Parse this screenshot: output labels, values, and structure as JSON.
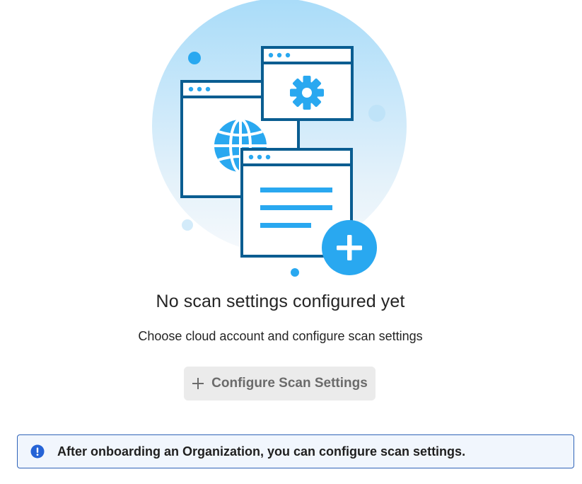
{
  "empty_state": {
    "title": "No scan settings configured yet",
    "subtitle": "Choose cloud account and configure scan settings",
    "illustration_icons": [
      "browser-window-globe",
      "browser-window-gear",
      "browser-window-document",
      "plus-badge"
    ]
  },
  "configure_button": {
    "label": "Configure Scan Settings",
    "icon": "plus-icon",
    "disabled": true
  },
  "info_message": {
    "icon": "info-icon",
    "text": "After onboarding an Organization, you can configure scan settings."
  },
  "colors": {
    "illustration_blue": "#29a8f0",
    "illustration_navy": "#0a5d91",
    "button_bg": "#ebebeb",
    "button_text": "#6b6b6b",
    "info_bg": "#f1f6fd",
    "info_border": "#2f63b8",
    "info_icon": "#2563d6"
  }
}
